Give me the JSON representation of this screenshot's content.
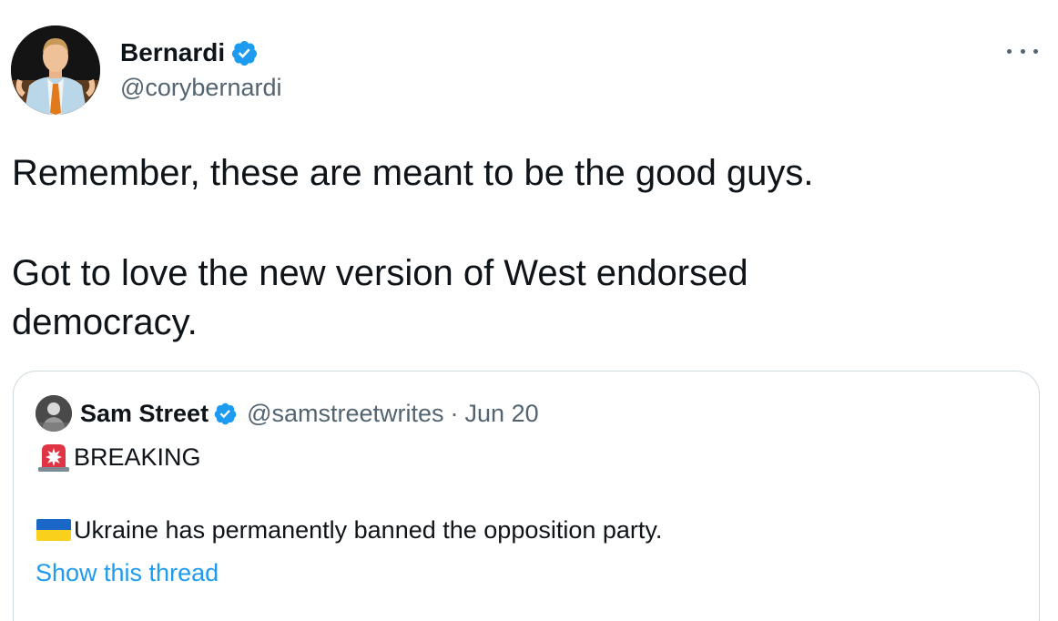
{
  "tweet": {
    "author": {
      "name": "Bernardi",
      "handle": "@corybernardi",
      "verified": true
    },
    "more_icon": "more-horizontal-icon",
    "text": {
      "paragraph1": "Remember, these are meant to be the good guys.",
      "paragraph2": "Got to love the new version of West endorsed democracy."
    },
    "quoted": {
      "name": "Sam Street",
      "handle": "@samstreetwrites",
      "separator": "·",
      "date": "Jun 20",
      "line1": "BREAKING",
      "line1_icon": "siren-icon",
      "line2": "Ukraine has permanently banned the opposition party.",
      "line2_icon": "ukraine-flag-icon",
      "show_thread": "Show this thread"
    }
  },
  "colors": {
    "text": "#0f1419",
    "secondary": "#536471",
    "link": "#1d9bf0",
    "verified": "#1d9bf0",
    "border": "#cfd9de"
  }
}
